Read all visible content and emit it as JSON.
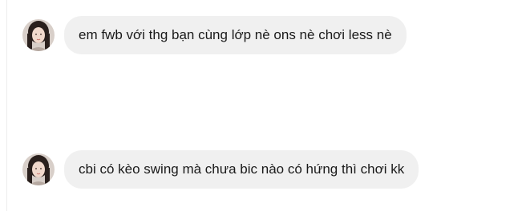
{
  "conversation": {
    "messages": [
      {
        "sender_avatar": "profile-photo",
        "text": "em fwb với thg bạn cùng lớp nè ons nè chơi less nè"
      },
      {
        "sender_avatar": "profile-photo",
        "text": "cbi có kèo swing mà chưa bic nào có hứng thì chơi kk"
      }
    ]
  },
  "colors": {
    "bubble_background": "#f0f0f0",
    "text": "#1a1a1a",
    "page_background": "#ffffff"
  }
}
